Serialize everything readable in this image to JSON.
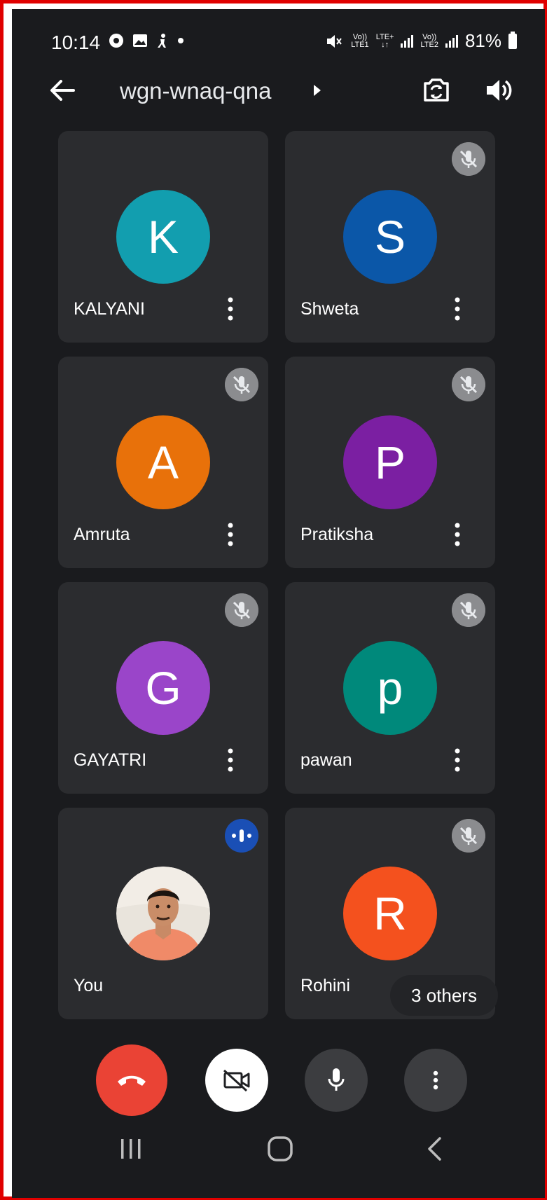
{
  "status_bar": {
    "time": "10:14",
    "battery": "81%",
    "network_labels": [
      "Vo))",
      "LTE+",
      "LTE1",
      "Vo))",
      "LTE2"
    ]
  },
  "top_bar": {
    "meeting_code": "wgn-wnaq-qna"
  },
  "participants": [
    {
      "name": "KALYANI",
      "initial": "K",
      "color": "#129eaf",
      "muted": false
    },
    {
      "name": "Shweta",
      "initial": "S",
      "color": "#0b57a8",
      "muted": true
    },
    {
      "name": "Amruta",
      "initial": "A",
      "color": "#e8710a",
      "muted": true
    },
    {
      "name": "Pratiksha",
      "initial": "P",
      "color": "#7b1fa2",
      "muted": true
    },
    {
      "name": "GAYATRI",
      "initial": "G",
      "color": "#9a45c9",
      "muted": true
    },
    {
      "name": "pawan",
      "initial": "p",
      "color": "#00897b",
      "muted": true
    },
    {
      "name": "You",
      "initial": "",
      "color": "#d8a88a",
      "muted": false,
      "speaking": true
    },
    {
      "name": "Rohini",
      "initial": "R",
      "color": "#f4511e",
      "muted": true
    }
  ],
  "others_chip": "3 others",
  "colors": {
    "background": "#1a1b1e",
    "tile": "#2b2c2f",
    "end_call": "#ea4335",
    "speaking_badge": "#1a4fb5",
    "mute_badge": "#8b8c8f"
  },
  "icons": {
    "back": "arrow-left-icon",
    "switch_camera": "switch-camera-icon",
    "speaker": "speaker-icon",
    "end_call": "phone-hangup-icon",
    "camera_off": "video-off-icon",
    "mic": "mic-icon",
    "more": "more-vert-icon"
  }
}
